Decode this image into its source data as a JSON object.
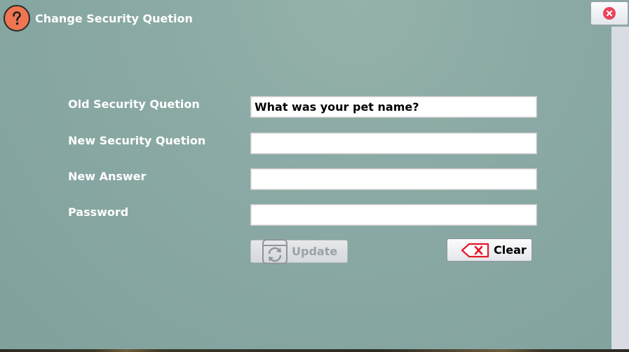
{
  "window": {
    "title": "Change Security Quetion",
    "title_icon": "question-mark-icon",
    "close_icon": "close-icon"
  },
  "form": {
    "fields": [
      {
        "label": "Old Security Quetion",
        "value": "What was your pet name?",
        "placeholder": ""
      },
      {
        "label": "New Security Quetion",
        "value": "",
        "placeholder": ""
      },
      {
        "label": "New Answer",
        "value": "",
        "placeholder": ""
      },
      {
        "label": "Password",
        "value": "",
        "placeholder": ""
      }
    ],
    "update_button": {
      "label": "Update",
      "enabled": false,
      "icon": "refresh-icon"
    },
    "clear_button": {
      "label": "Clear",
      "enabled": true,
      "icon": "clear-icon"
    }
  },
  "colors": {
    "title_icon_bg": "#ef7650",
    "close_accent": "#e9455a",
    "clear_accent": "#e21a2a",
    "background": "#8aa9a4"
  }
}
